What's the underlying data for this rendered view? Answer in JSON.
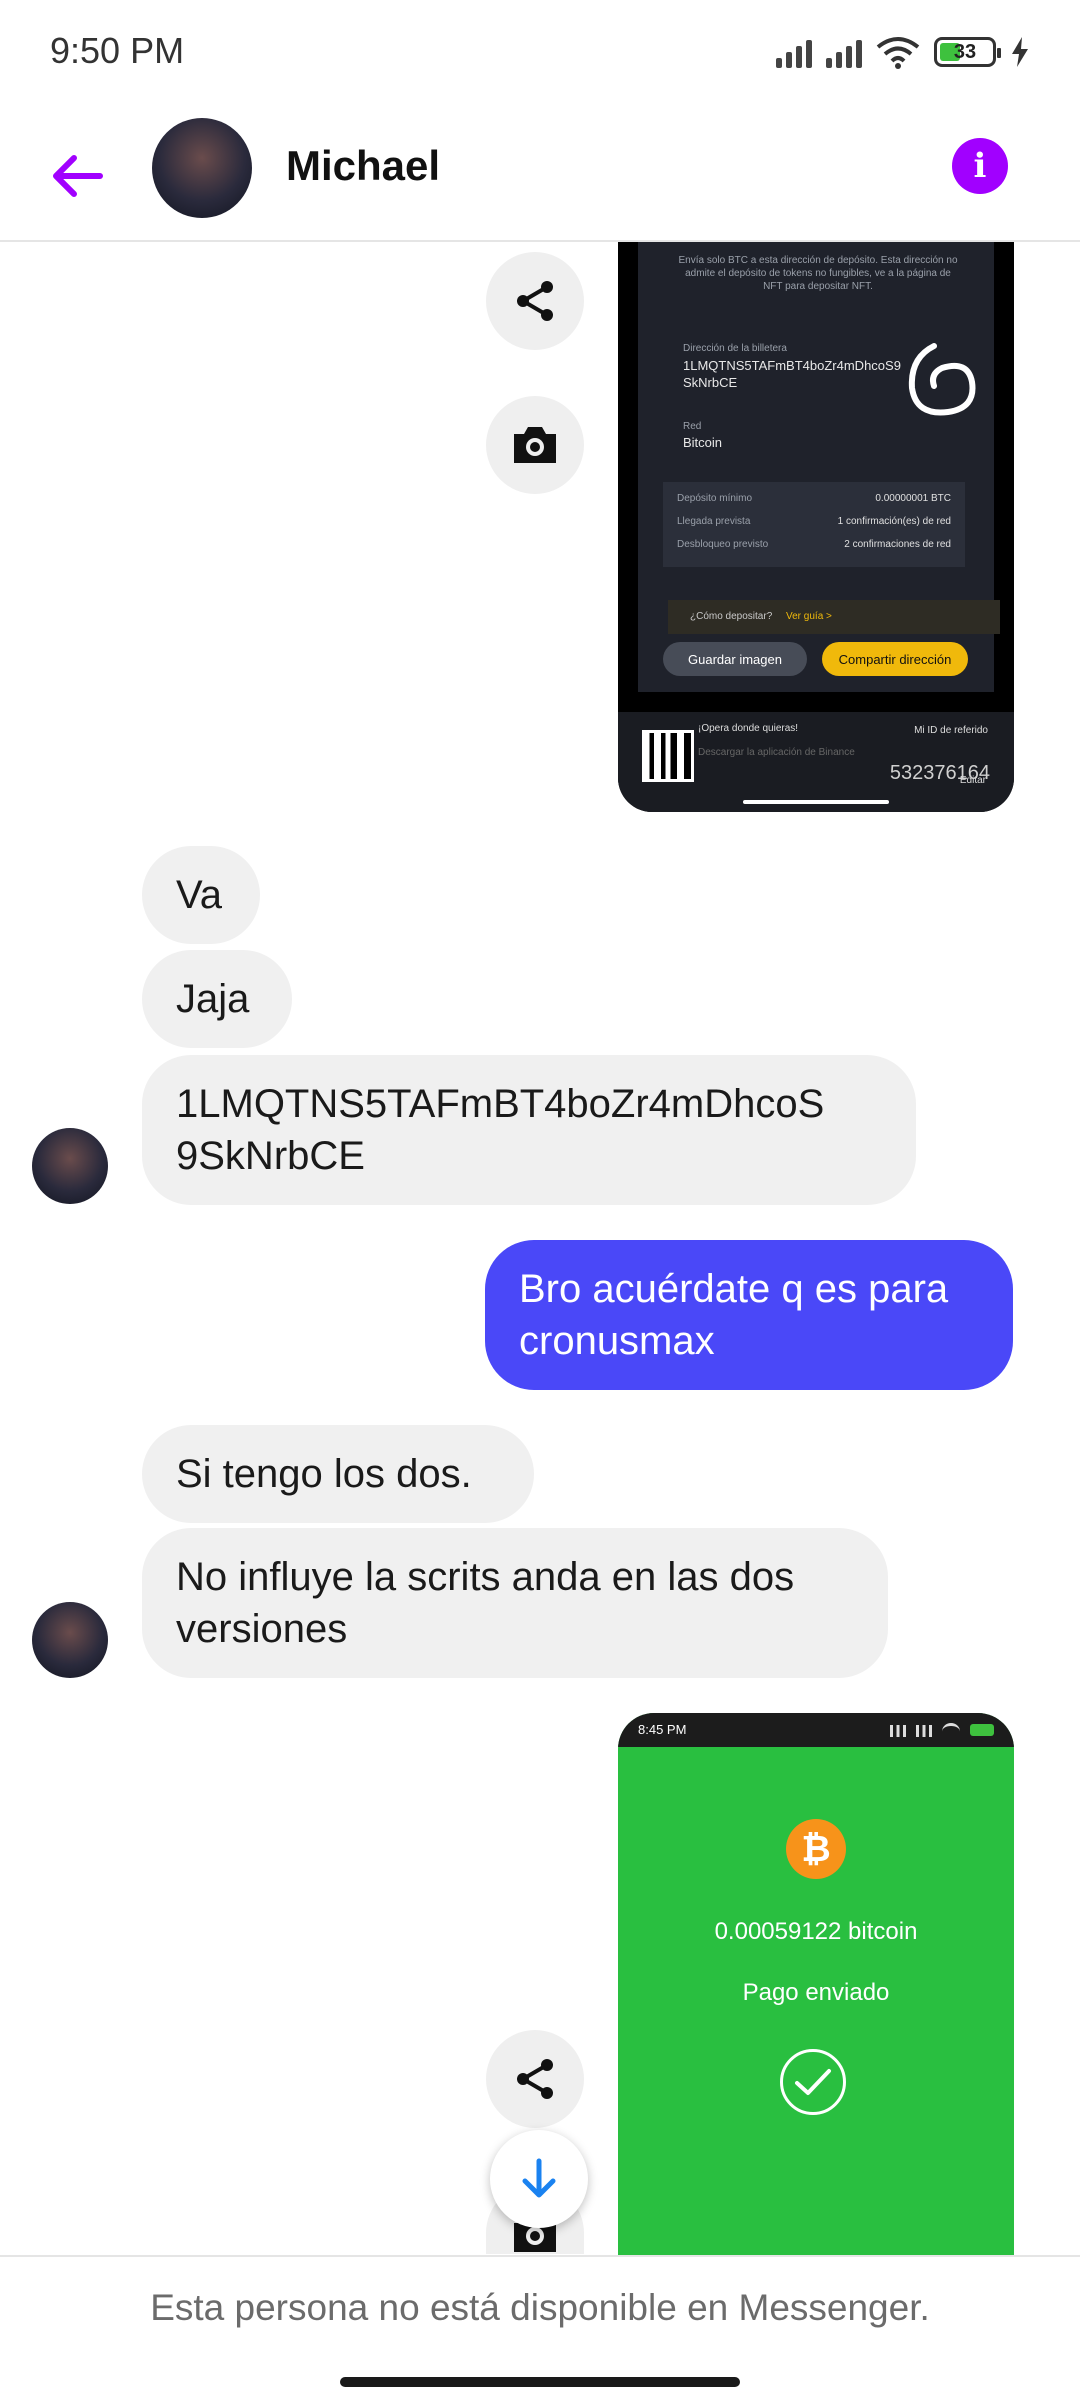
{
  "status_bar": {
    "time": "9:50 PM",
    "battery": "33"
  },
  "header": {
    "contact_name": "Michael"
  },
  "shot1": {
    "notice": "Envía solo BTC a esta dirección de depósito. Esta dirección no admite el depósito de tokens no fungibles, ve a la página de NFT para depositar NFT.",
    "wallet_label": "Dirección de la billetera",
    "wallet_line1": "1LMQTNS5TAFmBT4boZr4mDhcoS9",
    "wallet_line2": "SkNrbCE",
    "network_label": "Red",
    "network_value": "Bitcoin",
    "min_label": "Depósito mínimo",
    "min_value": "0.00000001 BTC",
    "arrival_label": "Llegada prevista",
    "arrival_value": "1 confirmación(es) de red",
    "unlock_label": "Desbloqueo previsto",
    "unlock_value": "2 confirmaciones de red",
    "tip": "¿Cómo depositar?",
    "tip_link": "Ver guía >",
    "save_image": "Guardar imagen",
    "share_address": "Compartir dirección",
    "trade_anywhere": "¡Opera donde quieras!",
    "download_app": "Descargar la aplicación de Binance",
    "referral_label": "Mi ID de referido",
    "referral_id": "532376164",
    "edit": "Editar"
  },
  "messages": {
    "m1": "Va",
    "m2": "Jaja",
    "m3_line1": "1LMQTNS5TAFmBT4boZr4mDhcoS",
    "m3_line2": "9SkNrbCE",
    "m4_line1": "Bro acuérdate q es para",
    "m4_line2": "cronusmax",
    "m5": "Si tengo los dos.",
    "m6_line1": "No influye la scrits anda en las dos",
    "m6_line2": "versiones"
  },
  "shot2": {
    "time": "8:45 PM",
    "btc_symbol": "₿",
    "amount": "0.00059122 bitcoin",
    "status": "Pago enviado"
  },
  "footer": {
    "notice": "Esta persona no está disponible en Messenger."
  },
  "colors": {
    "accent": "#a100ff",
    "outgoing": "#4a48f8",
    "incoming": "#f0f0f0",
    "payment": "#29bf40"
  },
  "icons": {
    "back": "arrow-left-icon",
    "info": "info-icon",
    "share": "share-icon",
    "camera": "camera-icon",
    "scroll": "arrow-down-icon",
    "check": "check-icon",
    "bitcoin": "bitcoin-icon"
  }
}
